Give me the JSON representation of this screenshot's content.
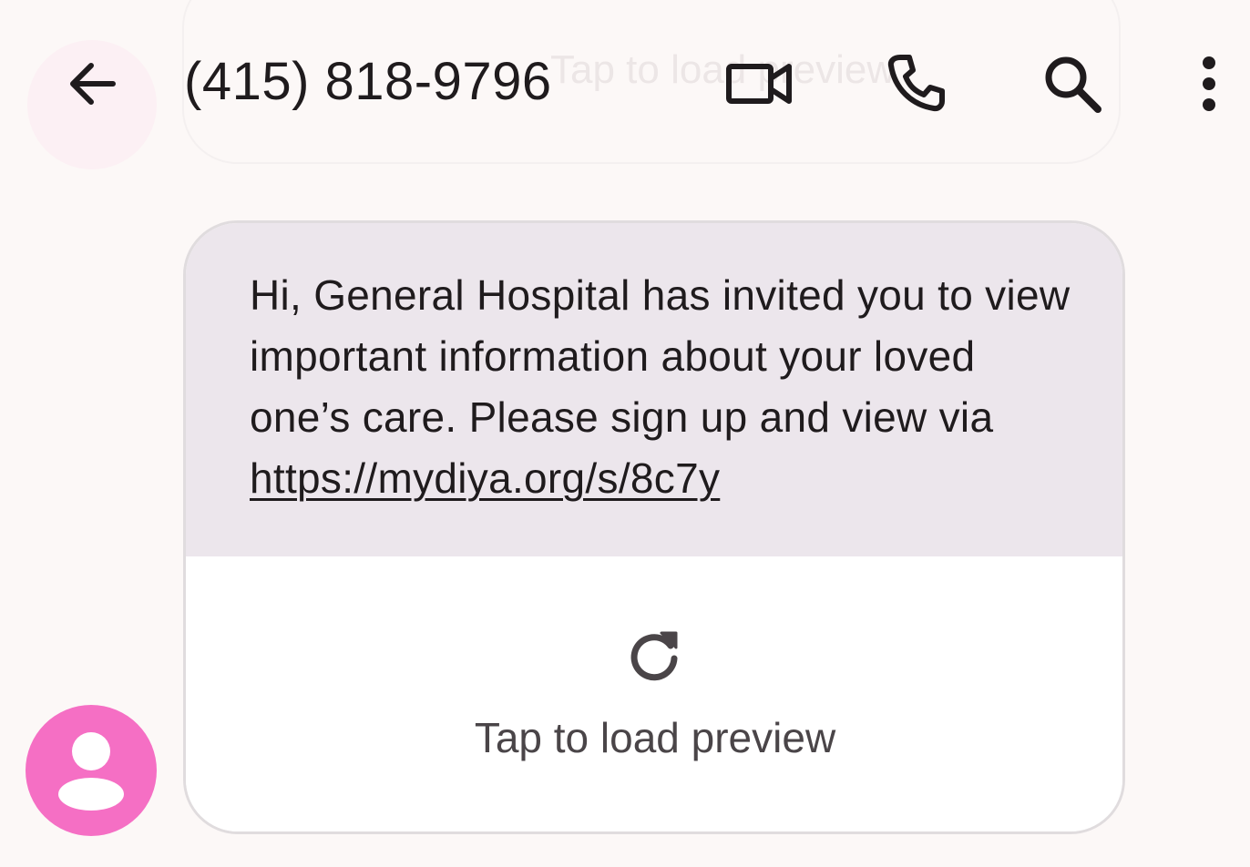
{
  "header": {
    "contact_title": "(415) 818-9796",
    "back_icon": "arrow-left-icon",
    "video_icon": "video-camera-icon",
    "call_icon": "phone-icon",
    "search_icon": "search-icon",
    "more_icon": "more-vertical-icon"
  },
  "message": {
    "text": "Hi, General Hospital has invited you to view important information about your loved one’s care. Please sign up and view via ",
    "link": "https://mydiya.org/s/8c7y",
    "preview_icon": "refresh-icon",
    "preview_label": "Tap to load preview"
  },
  "sender": {
    "avatar_icon": "person-icon",
    "avatar_color": "#f56fc4"
  },
  "colors": {
    "background": "#fcf8f7",
    "bubble": "#ece6ec",
    "text": "#1f1b1d"
  }
}
